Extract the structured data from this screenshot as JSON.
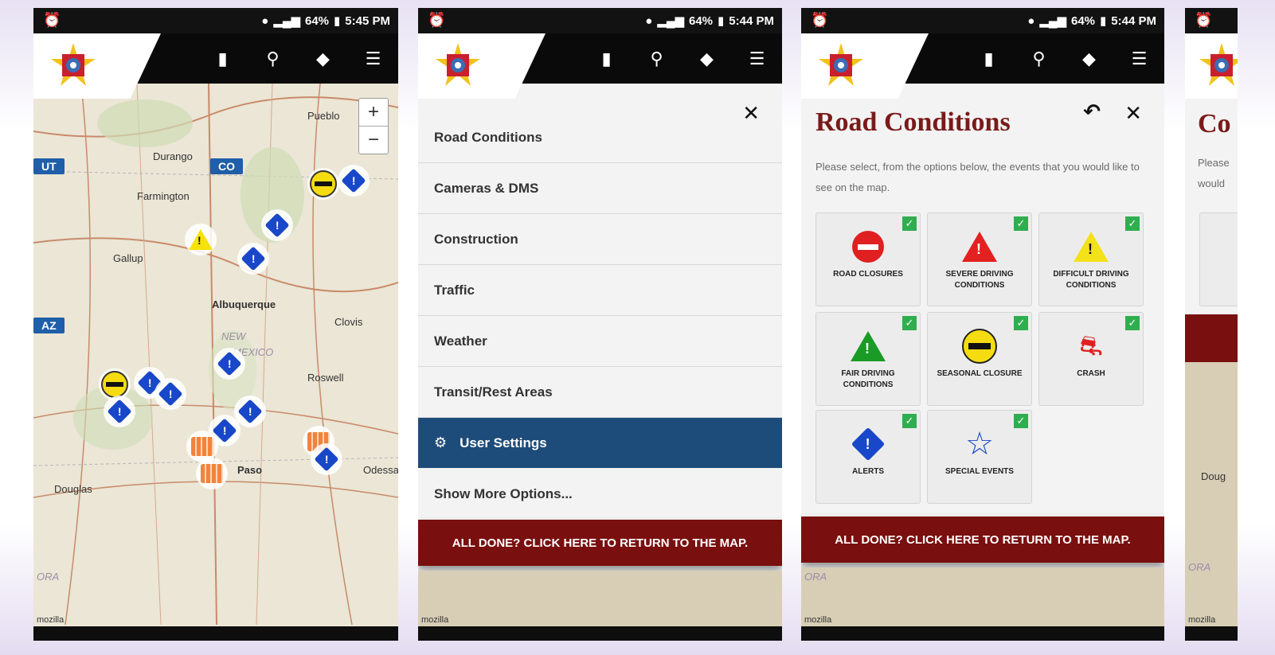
{
  "status": {
    "screen1_time": "5:45 PM",
    "screen2_time": "5:44 PM",
    "screen3_time": "5:44 PM",
    "battery": "64%"
  },
  "map": {
    "states": [
      "UT",
      "CO",
      "AZ"
    ],
    "cities": [
      "Pueblo",
      "Durango",
      "Farmington",
      "Gallup",
      "Albuquerque",
      "Clovis",
      "Roswell",
      "Douglas",
      "Paso",
      "Odessa",
      "NEW",
      "MEXICO",
      "ORA",
      "mozilla"
    ],
    "zoom_in": "+",
    "zoom_out": "−"
  },
  "menu": {
    "items": [
      "Road Conditions",
      "Cameras & DMS",
      "Construction",
      "Traffic",
      "Weather",
      "Transit/Rest Areas"
    ],
    "settings": "User Settings",
    "more": "Show More Options...",
    "close": "✕"
  },
  "done_bar": "ALL DONE? CLICK HERE TO RETURN TO THE MAP.",
  "road_conditions": {
    "title": "Road Conditions",
    "description": "Please select, from the options below, the events that you would like to see on the map.",
    "tiles": [
      {
        "label": "ROAD CLOSURES",
        "icon": "no-entry-icon"
      },
      {
        "label": "SEVERE DRIVING CONDITIONS",
        "icon": "red-warning-icon"
      },
      {
        "label": "DIFFICULT DRIVING CONDITIONS",
        "icon": "yellow-warning-icon"
      },
      {
        "label": "FAIR DRIVING CONDITIONS",
        "icon": "green-warning-icon"
      },
      {
        "label": "SEASONAL CLOSURE",
        "icon": "seasonal-closure-icon"
      },
      {
        "label": "CRASH",
        "icon": "crash-icon"
      },
      {
        "label": "ALERTS",
        "icon": "alert-diamond-icon"
      },
      {
        "label": "SPECIAL EVENTS",
        "icon": "star-icon"
      }
    ]
  },
  "partial": {
    "title": "Co",
    "desc1": "Please",
    "desc2": "would",
    "city": "Doug"
  },
  "colors": {
    "header": "#0a0a0a",
    "active_menu": "#1e4c7a",
    "done_bar": "#7a0f0f",
    "title": "#7a1a1a",
    "check": "#2fae4f"
  }
}
